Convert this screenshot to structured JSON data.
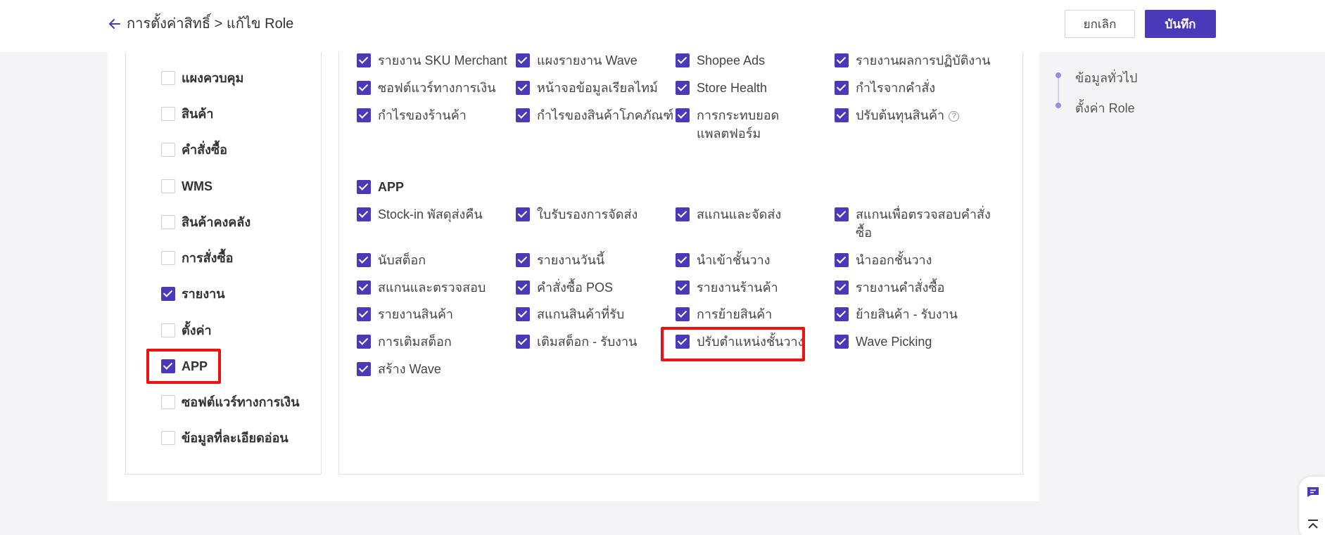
{
  "header": {
    "breadcrumb": "การตั้งค่าสิทธิ์ > แก้ไข Role",
    "cancel_label": "ยกเลิก",
    "save_label": "บันทึก"
  },
  "left_menu": [
    {
      "label": "แผงควบคุม",
      "checked": false
    },
    {
      "label": "สินค้า",
      "checked": false
    },
    {
      "label": "คำสั่งซื้อ",
      "checked": false
    },
    {
      "label": "WMS",
      "checked": false
    },
    {
      "label": "สินค้าคงคลัง",
      "checked": false
    },
    {
      "label": "การสั่งซื้อ",
      "checked": false
    },
    {
      "label": "รายงาน",
      "checked": true
    },
    {
      "label": "ตั้งค่า",
      "checked": false
    },
    {
      "label": "APP",
      "checked": true
    },
    {
      "label": "ซอฟต์แวร์ทางการเงิน",
      "checked": false
    },
    {
      "label": "ข้อมูลที่ละเอียดอ่อน",
      "checked": false
    }
  ],
  "report_items": [
    {
      "label": "รายงาน SKU Merchant",
      "checked": true
    },
    {
      "label": "แผงรายงาน Wave",
      "checked": true
    },
    {
      "label": "Shopee Ads",
      "checked": true
    },
    {
      "label": "รายงานผลการปฏิบัติงาน",
      "checked": true
    },
    {
      "label": "ซอฟต์แวร์ทางการเงิน",
      "checked": true
    },
    {
      "label": "หน้าจอข้อมูลเรียลไทม์",
      "checked": true
    },
    {
      "label": "Store Health",
      "checked": true
    },
    {
      "label": "กำไรจากคำสั่ง",
      "checked": true
    },
    {
      "label": "กำไรของร้านค้า",
      "checked": true
    },
    {
      "label": "กำไรของสินค้าโภคภัณฑ์",
      "checked": true
    },
    {
      "label": "การกระทบยอดแพลตฟอร์ม",
      "checked": true
    },
    {
      "label": "ปรับต้นทุนสินค้า",
      "checked": true
    }
  ],
  "app_section": {
    "title": "APP",
    "checked": true,
    "items": [
      {
        "label": "Stock-in พัสดุส่งคืน",
        "checked": true
      },
      {
        "label": "ใบรับรองการจัดส่ง",
        "checked": true
      },
      {
        "label": "สแกนและจัดส่ง",
        "checked": true
      },
      {
        "label": "สแกนเพื่อตรวจสอบคำสั่งซื้อ",
        "checked": true
      },
      {
        "label": "นับสต็อก",
        "checked": true
      },
      {
        "label": "รายงานวันนี้",
        "checked": true
      },
      {
        "label": "นำเข้าชั้นวาง",
        "checked": true
      },
      {
        "label": "นำออกชั้นวาง",
        "checked": true
      },
      {
        "label": "สแกนและตรวจสอบ",
        "checked": true
      },
      {
        "label": "คำสั่งซื้อ POS",
        "checked": true
      },
      {
        "label": "รายงานร้านค้า",
        "checked": true
      },
      {
        "label": "รายงานคำสั่งซื้อ",
        "checked": true
      },
      {
        "label": "รายงานสินค้า",
        "checked": true
      },
      {
        "label": "สแกนสินค้าที่รับ",
        "checked": true
      },
      {
        "label": "การย้ายสินค้า",
        "checked": true
      },
      {
        "label": "ย้ายสินค้า - รับงาน",
        "checked": true
      },
      {
        "label": "การเติมสต็อก",
        "checked": true
      },
      {
        "label": "เติมสต็อก - รับงาน",
        "checked": true
      },
      {
        "label": "ปรับตำแหน่งชั้นวาง",
        "checked": true
      },
      {
        "label": "Wave Picking",
        "checked": true
      },
      {
        "label": "สร้าง Wave",
        "checked": true
      }
    ]
  },
  "right_nav": {
    "items": [
      "ข้อมูลทั่วไป",
      "ตั้งค่า Role"
    ]
  },
  "colors": {
    "accent": "#4a39b8",
    "highlight": "#ee1111"
  },
  "icons": [
    "back-arrow-icon",
    "help-icon",
    "chat-icon",
    "back-to-top-icon"
  ]
}
